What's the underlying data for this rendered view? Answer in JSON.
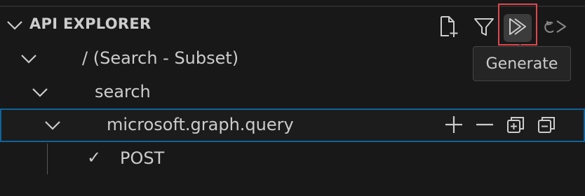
{
  "header": {
    "title": "API EXPLORER",
    "toolbar": [
      {
        "name": "new-file",
        "icon": "new-file-icon"
      },
      {
        "name": "filter",
        "icon": "filter-icon"
      },
      {
        "name": "generate",
        "icon": "run-all-icon"
      },
      {
        "name": "regenerate",
        "icon": "refresh-run-icon"
      }
    ]
  },
  "tooltip": {
    "text": "Generate"
  },
  "tree": {
    "root_label": "/ (Search - Subset)",
    "search_label": "search",
    "query_label": "microsoft.graph.query",
    "post_label": "POST",
    "post_check": "✓"
  },
  "colors": {
    "background": "#181818",
    "selection_border": "#0e639c",
    "highlight_border": "#e0474c",
    "text": "#cccccc"
  }
}
